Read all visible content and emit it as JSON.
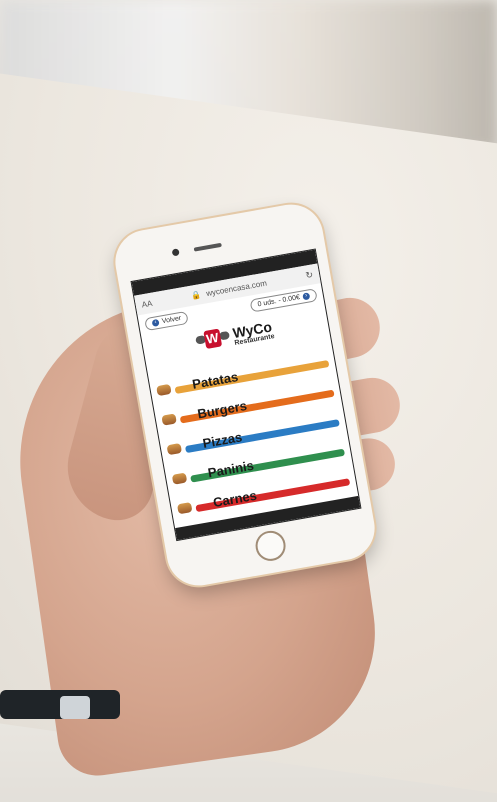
{
  "browser": {
    "aa_label": "AA",
    "url": "wycoencasa.com",
    "reload_icon": "reload-icon",
    "lock_icon": "lock-icon"
  },
  "toolbar": {
    "back_label": "Volver",
    "cart_label": "0 uds. - 0.00€"
  },
  "logo": {
    "title": "WyCo",
    "subtitle": "Restaurante",
    "letter": "W"
  },
  "menu": [
    {
      "label": "Patatas",
      "color": "#e8a23a"
    },
    {
      "label": "Burgers",
      "color": "#e46c1c"
    },
    {
      "label": "Pizzas",
      "color": "#2b7cc4"
    },
    {
      "label": "Paninis",
      "color": "#2f8f4e"
    },
    {
      "label": "Carnes",
      "color": "#d62a2a"
    }
  ]
}
